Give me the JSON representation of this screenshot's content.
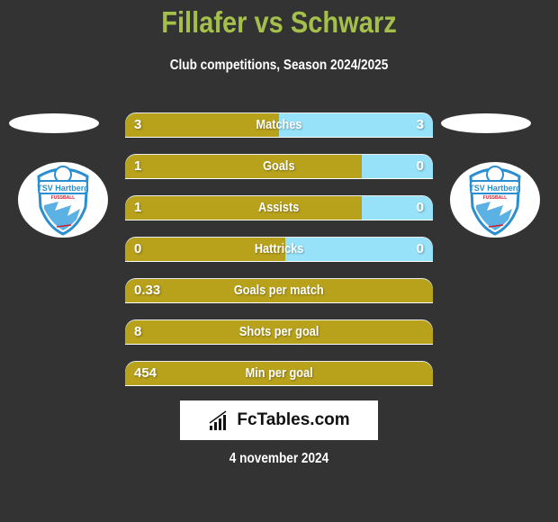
{
  "header": {
    "title": "Fillafer vs Schwarz",
    "subtitle": "Club competitions, Season 2024/2025"
  },
  "teams": {
    "left": {
      "badge_text": "TSV Hartberg",
      "badge_sub": "FUSSBALL"
    },
    "right": {
      "badge_text": "TSV Hartberg",
      "badge_sub": "FUSSBALL"
    }
  },
  "colors": {
    "title": "#a4c04a",
    "left_bar": "#b8a21c",
    "right_bar": "#97e2f8",
    "background": "#333333"
  },
  "stats": [
    {
      "label": "Matches",
      "left": "3",
      "right": "3",
      "left_share": 0.5
    },
    {
      "label": "Goals",
      "left": "1",
      "right": "0",
      "left_share": 0.77
    },
    {
      "label": "Assists",
      "left": "1",
      "right": "0",
      "left_share": 0.77
    },
    {
      "label": "Hattricks",
      "left": "0",
      "right": "0",
      "left_share": 0.52
    },
    {
      "label": "Goals per match",
      "left": "0.33",
      "right": "",
      "left_share": 1.0
    },
    {
      "label": "Shots per goal",
      "left": "8",
      "right": "",
      "left_share": 1.0
    },
    {
      "label": "Min per goal",
      "left": "454",
      "right": "",
      "left_share": 1.0
    }
  ],
  "brand": {
    "name": "FcTables.com",
    "icon": "bar-chart-icon"
  },
  "footer": {
    "date": "4 november 2024"
  }
}
